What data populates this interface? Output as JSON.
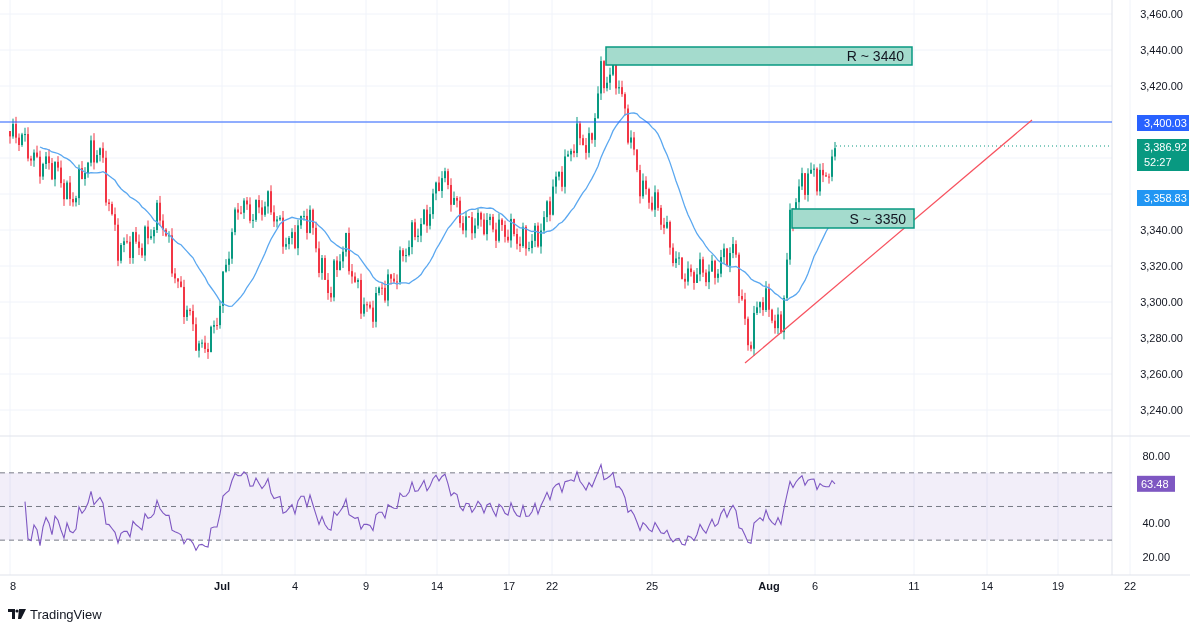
{
  "price_axis": {
    "labels": [
      "3,460.00",
      "3,440.00",
      "3,420.00",
      "3,340.00",
      "3,320.00",
      "3,300.00",
      "3,280.00",
      "3,260.00",
      "3,240.00"
    ]
  },
  "price_tags": [
    {
      "kind": "line",
      "text": "3,400.03",
      "color": "#2962ff"
    },
    {
      "kind": "last",
      "text": "3,386.92",
      "countdown": "52:27",
      "color": "#089981"
    },
    {
      "kind": "ma",
      "text": "3,358.83",
      "color": "#2196f3"
    }
  ],
  "zones": [
    {
      "kind": "resistance",
      "label": "R ~ 3440"
    },
    {
      "kind": "support",
      "label": "S ~ 3350"
    }
  ],
  "rsi": {
    "axis_labels": [
      "80.00",
      "40.00",
      "20.00"
    ],
    "tag": "63.48"
  },
  "time_axis": [
    {
      "kind": "day",
      "label": "8"
    },
    {
      "kind": "month",
      "label": "Jul"
    },
    {
      "kind": "day",
      "label": "4"
    },
    {
      "kind": "day",
      "label": "9"
    },
    {
      "kind": "day",
      "label": "14"
    },
    {
      "kind": "day",
      "label": "17"
    },
    {
      "kind": "day",
      "label": "22"
    },
    {
      "kind": "day",
      "label": "25"
    },
    {
      "kind": "month",
      "label": "Aug"
    },
    {
      "kind": "day",
      "label": "6"
    },
    {
      "kind": "day",
      "label": "11"
    },
    {
      "kind": "day",
      "label": "14"
    },
    {
      "kind": "day",
      "label": "19"
    },
    {
      "kind": "day",
      "label": "22"
    }
  ],
  "footer": {
    "brand": "TradingView"
  }
}
